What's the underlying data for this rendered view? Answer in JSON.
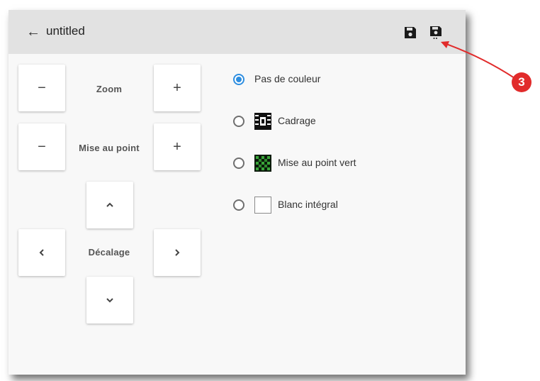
{
  "header": {
    "back_icon": "arrow-left-icon",
    "title": "untitled",
    "save_icon": "floppy-disk-icon",
    "save_as_icon": "floppy-disk-dots-icon"
  },
  "controls": {
    "zoom": {
      "label": "Zoom",
      "minus": "−",
      "plus": "+"
    },
    "focus": {
      "label": "Mise au point",
      "minus": "−",
      "plus": "+"
    },
    "offset": {
      "label": "Décalage",
      "up_icon": "chevron-up-icon",
      "down_icon": "chevron-down-icon",
      "left_icon": "chevron-left-icon",
      "right_icon": "chevron-right-icon"
    }
  },
  "color_options": {
    "selected": "Pas de couleur",
    "items": [
      {
        "label": "Pas de couleur",
        "checked": true
      },
      {
        "label": "Cadrage",
        "checked": false,
        "swatch": "cadrage-pattern"
      },
      {
        "label": "Mise au point vert",
        "checked": false,
        "swatch": "green-focus-pattern"
      },
      {
        "label": "Blanc intégral",
        "checked": false,
        "swatch": "white"
      }
    ]
  },
  "annotation": {
    "step_number": "3",
    "color": "#e12b2b"
  },
  "colors": {
    "accent": "#2e8ee0",
    "toolbar": "#e2e2e2",
    "panel": "#f8f8f8"
  }
}
